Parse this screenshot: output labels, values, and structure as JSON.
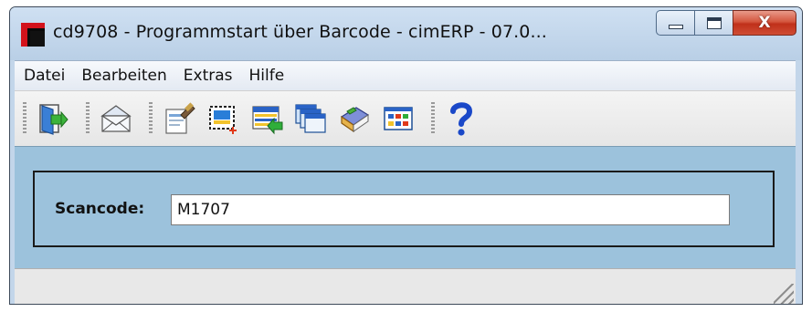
{
  "window": {
    "title": "cd9708  - Programmstart über Barcode - cimERP - 07.0...",
    "caption": {
      "minimize": "–",
      "maximize": "□",
      "close": "X"
    }
  },
  "menubar": {
    "items": [
      "Datei",
      "Bearbeiten",
      "Extras",
      "Hilfe"
    ]
  },
  "toolbar": {
    "buttons": [
      {
        "icon": "exit-door-icon"
      },
      {
        "icon": "mail-envelope-icon"
      },
      {
        "icon": "edit-document-icon"
      },
      {
        "icon": "new-selection-icon"
      },
      {
        "icon": "import-list-icon"
      },
      {
        "icon": "windows-cascade-icon"
      },
      {
        "icon": "book-icon"
      },
      {
        "icon": "grid-table-icon"
      },
      {
        "icon": "help-icon"
      }
    ]
  },
  "form": {
    "scancode_label": "Scancode:",
    "scancode_value": "M1707"
  },
  "colors": {
    "content_bg": "#9cc2dc",
    "close_button": "#c9412a",
    "help_blue": "#1a48c8"
  }
}
